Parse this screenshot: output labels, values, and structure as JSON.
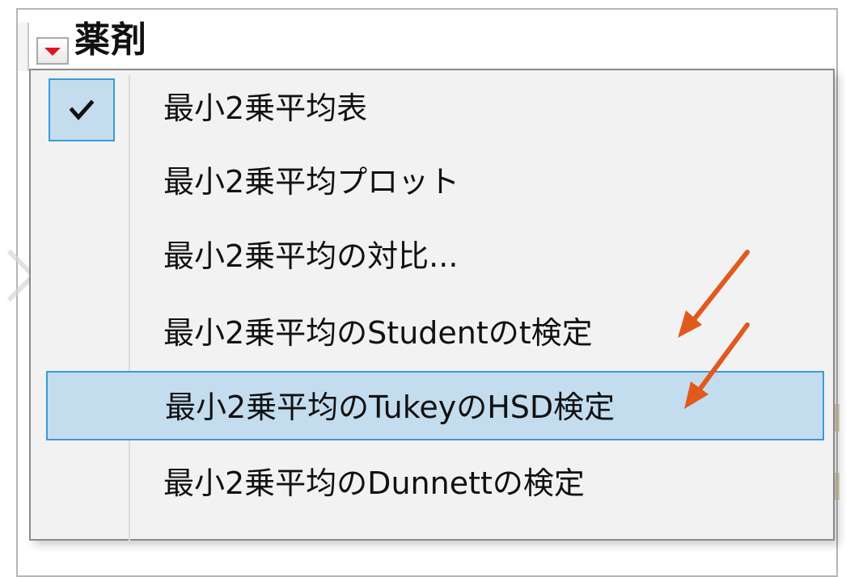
{
  "report": {
    "outline_title": "薬剤"
  },
  "menu": {
    "items": [
      {
        "label": "最小2乗平均表",
        "checked": true,
        "highlighted": false
      },
      {
        "label": "最小2乗平均プロット",
        "checked": false,
        "highlighted": false
      },
      {
        "label": "最小2乗平均の対比...",
        "checked": false,
        "highlighted": false
      },
      {
        "label": "最小2乗平均のStudentのt検定",
        "checked": false,
        "highlighted": false
      },
      {
        "label": "最小2乗平均のTukeyのHSD検定",
        "checked": false,
        "highlighted": true
      },
      {
        "label": "最小2乗平均のDunnettの検定",
        "checked": false,
        "highlighted": false
      }
    ]
  },
  "icons": {
    "disclosure": "red-triangle-menu-icon",
    "check": "checkmark-icon",
    "annotation": "red-arrow-icon"
  },
  "colors": {
    "menu_background": "#f2f2f2",
    "highlight_fill": "#c3dcee",
    "highlight_border": "#3b9ad8",
    "disclosure_triangle": "#e0141e",
    "annotation_arrow": "#e05a1e"
  }
}
